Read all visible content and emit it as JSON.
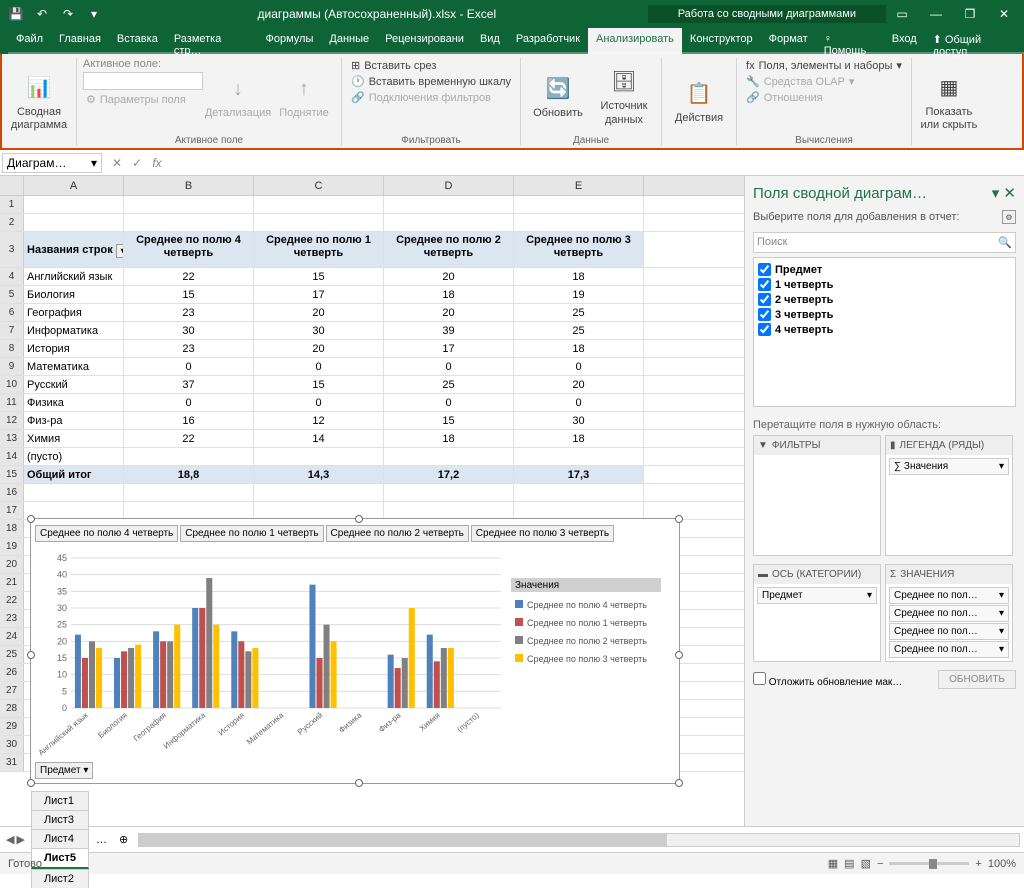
{
  "titlebar": {
    "filename": "диаграммы (Автосохраненный).xlsx - Excel",
    "context": "Работа со сводными диаграммами"
  },
  "menu": [
    "Файл",
    "Главная",
    "Вставка",
    "Разметка стр…",
    "Формулы",
    "Данные",
    "Рецензировани",
    "Вид",
    "Разработчик",
    "Анализировать",
    "Конструктор",
    "Формат",
    "♀ Помощь",
    "Вход",
    "⬆ Общий доступ"
  ],
  "ribbon": {
    "g1": {
      "btn": "Сводная\nдиаграмма",
      "label": ""
    },
    "g2": {
      "field_label": "Активное поле:",
      "params": "Параметры поля",
      "detail": "Детализация",
      "up": "Поднятие",
      "label": "Активное поле"
    },
    "g3": {
      "slice": "Вставить срез",
      "timeline": "Вставить временную шкалу",
      "conn": "Подключения фильтров",
      "label": "Фильтровать"
    },
    "g4": {
      "refresh": "Обновить",
      "source": "Источник\nданных",
      "label": "Данные"
    },
    "g5": {
      "actions": "Действия"
    },
    "g6": {
      "fields": "Поля, элементы и наборы",
      "olap": "Средства OLAP",
      "rel": "Отношения",
      "label": "Вычисления"
    },
    "g7": {
      "show": "Показать или\nскрыть"
    }
  },
  "namebox": "Диаграм…",
  "columns": [
    "A",
    "B",
    "C",
    "D",
    "E"
  ],
  "table": {
    "hdr_row": "Названия строк",
    "hdrs": [
      "Среднее по полю 4 четверть",
      "Среднее по полю 1 четверть",
      "Среднее по полю 2 четверть",
      "Среднее по полю 3 четверть"
    ],
    "rows": [
      {
        "n": 4,
        "name": "Английский язык",
        "v": [
          22,
          15,
          20,
          18
        ]
      },
      {
        "n": 5,
        "name": "Биология",
        "v": [
          15,
          17,
          18,
          19
        ]
      },
      {
        "n": 6,
        "name": "География",
        "v": [
          23,
          20,
          20,
          25
        ]
      },
      {
        "n": 7,
        "name": "Информатика",
        "v": [
          30,
          30,
          39,
          25
        ]
      },
      {
        "n": 8,
        "name": "История",
        "v": [
          23,
          20,
          17,
          18
        ]
      },
      {
        "n": 9,
        "name": "Математика",
        "v": [
          0,
          0,
          0,
          0
        ]
      },
      {
        "n": 10,
        "name": "Русский",
        "v": [
          37,
          15,
          25,
          20
        ]
      },
      {
        "n": 11,
        "name": "Физика",
        "v": [
          0,
          0,
          0,
          0
        ]
      },
      {
        "n": 12,
        "name": "Физ-ра",
        "v": [
          16,
          12,
          15,
          30
        ]
      },
      {
        "n": 13,
        "name": "Химия",
        "v": [
          22,
          14,
          18,
          18
        ]
      },
      {
        "n": 14,
        "name": "(пусто)",
        "v": [
          "",
          "",
          "",
          ""
        ]
      }
    ],
    "total": {
      "n": 15,
      "name": "Общий итог",
      "v": [
        "18,8",
        "14,3",
        "17,2",
        "17,3"
      ]
    }
  },
  "chart": {
    "buttons": [
      "Среднее по полю 4 четверть",
      "Среднее по полю 1 четверть",
      "Среднее по полю 2 четверть",
      "Среднее по полю 3 четверть"
    ],
    "legend_title": "Значения",
    "filter": "Предмет"
  },
  "chart_data": {
    "type": "bar",
    "categories": [
      "Английский язык",
      "Биология",
      "География",
      "Информатика",
      "История",
      "Математика",
      "Русский",
      "Физика",
      "Физ-ра",
      "Химия",
      "(пусто)"
    ],
    "series": [
      {
        "name": "Среднее по полю 4 четверть",
        "color": "#4f81bd",
        "values": [
          22,
          15,
          23,
          30,
          23,
          0,
          37,
          0,
          16,
          22,
          0
        ]
      },
      {
        "name": "Среднее по полю 1 четверть",
        "color": "#c0504d",
        "values": [
          15,
          17,
          20,
          30,
          20,
          0,
          15,
          0,
          12,
          14,
          0
        ]
      },
      {
        "name": "Среднее по полю 2 четверть",
        "color": "#9bbb59",
        "darkcolor": "#808080",
        "values": [
          20,
          18,
          20,
          39,
          17,
          0,
          25,
          0,
          15,
          18,
          0
        ]
      },
      {
        "name": "Среднее по полю 3 четверть",
        "color": "#ffc000",
        "values": [
          18,
          19,
          25,
          25,
          18,
          0,
          20,
          0,
          30,
          18,
          0
        ]
      }
    ],
    "ylim": [
      0,
      45
    ],
    "yticks": [
      0,
      5,
      10,
      15,
      20,
      25,
      30,
      35,
      40,
      45
    ]
  },
  "pane": {
    "title": "Поля сводной диаграм…",
    "sub": "Выберите поля для добавления в отчет:",
    "search": "Поиск",
    "fields": [
      "Предмет",
      "1 четверть",
      "2 четверть",
      "3 четверть",
      "4 четверть"
    ],
    "drag": "Перетащите поля в нужную область:",
    "z_filters": "ФИЛЬТРЫ",
    "z_legend": "ЛЕГЕНДА (РЯДЫ)",
    "z_axis": "ОСЬ (КАТЕГОРИИ)",
    "z_values": "ЗНАЧЕНИЯ",
    "legend_item": "∑  Значения",
    "axis_item": "Предмет",
    "value_items": [
      "Среднее по пол…",
      "Среднее по пол…",
      "Среднее по пол…",
      "Среднее по пол…"
    ],
    "defer": "Отложить обновление мак…",
    "update": "ОБНОВИТЬ"
  },
  "sheets": [
    "Лист1",
    "Лист3",
    "Лист4",
    "Лист5",
    "Лист2"
  ],
  "status": {
    "ready": "Готово",
    "zoom": "100%"
  }
}
